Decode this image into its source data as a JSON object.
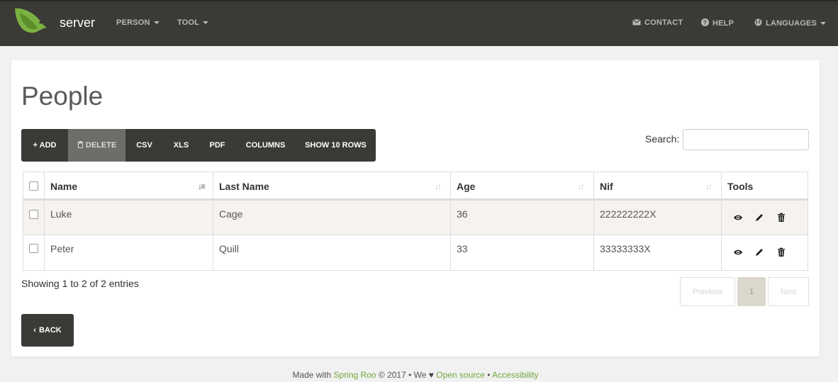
{
  "navbar": {
    "brand": "server",
    "menus": [
      {
        "label": "PERSON"
      },
      {
        "label": "TOOL"
      }
    ],
    "right": [
      {
        "label": "CONTACT",
        "icon": "envelope-icon"
      },
      {
        "label": "HELP",
        "icon": "question-circle-icon"
      },
      {
        "label": "LANGUAGES",
        "icon": "globe-icon"
      }
    ]
  },
  "page": {
    "title": "People"
  },
  "toolbar": {
    "add": "+ ADD",
    "delete": "DELETE",
    "csv": "CSV",
    "xls": "XLS",
    "pdf": "PDF",
    "columns": "COLUMNS",
    "show_rows": "SHOW 10 ROWS"
  },
  "search": {
    "label": "Search:",
    "value": ""
  },
  "table": {
    "columns": [
      "Name",
      "Last Name",
      "Age",
      "Nif",
      "Tools"
    ],
    "rows": [
      {
        "name": "Luke",
        "last_name": "Cage",
        "age": "36",
        "nif": "222222222X"
      },
      {
        "name": "Peter",
        "last_name": "Quill",
        "age": "33",
        "nif": "33333333X"
      }
    ]
  },
  "info": "Showing 1 to 2 of 2 entries",
  "pagination": {
    "previous": "Previous",
    "current": "1",
    "next": "Next"
  },
  "back": "BACK",
  "footer": {
    "made_with": "Made with",
    "spring_roo": "Spring Roo",
    "year": "© 2017 • We",
    "open_source": "Open source",
    "sep": "•",
    "accessibility": "Accessibility"
  },
  "colors": {
    "navbar": "#3b3a36",
    "accent_green": "#6fa83c",
    "row_stripe": "#f6f3ee"
  }
}
